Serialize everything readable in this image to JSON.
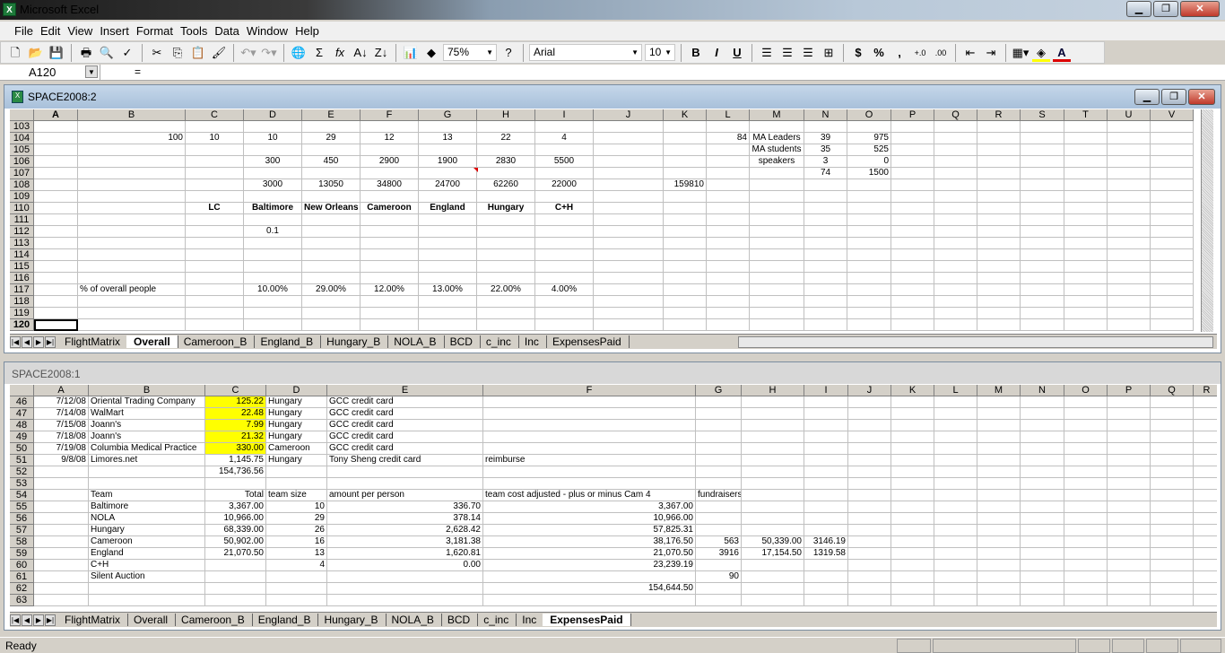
{
  "app": {
    "title": "Microsoft Excel"
  },
  "menu": [
    "File",
    "Edit",
    "View",
    "Insert",
    "Format",
    "Tools",
    "Data",
    "Window",
    "Help"
  ],
  "toolbar": {
    "zoom": "75%",
    "font": "Arial",
    "size": "10",
    "bold": "B",
    "italic": "I",
    "underline": "U",
    "currency": "$",
    "percent": "%",
    "comma": ","
  },
  "formula": {
    "name_box": "A120",
    "eq": "=",
    "value": ""
  },
  "win_top": {
    "title": "SPACE2008:2",
    "columns": [
      "A",
      "B",
      "C",
      "D",
      "E",
      "F",
      "G",
      "H",
      "I",
      "J",
      "K",
      "L",
      "M",
      "N",
      "O",
      "P",
      "Q",
      "R",
      "S",
      "T",
      "U",
      "V"
    ],
    "row_numbers": [
      "103",
      "104",
      "105",
      "106",
      "107",
      "108",
      "109",
      "110",
      "111",
      "112",
      "113",
      "114",
      "115",
      "116",
      "117",
      "118",
      "119",
      "120"
    ],
    "active_row": "120",
    "cells": [
      {
        "r": 1,
        "c": "B",
        "v": "100",
        "a": "r"
      },
      {
        "r": 1,
        "c": "C",
        "v": "10",
        "a": "c"
      },
      {
        "r": 1,
        "c": "D",
        "v": "10",
        "a": "c"
      },
      {
        "r": 1,
        "c": "E",
        "v": "29",
        "a": "c"
      },
      {
        "r": 1,
        "c": "F",
        "v": "12",
        "a": "c"
      },
      {
        "r": 1,
        "c": "G",
        "v": "13",
        "a": "c"
      },
      {
        "r": 1,
        "c": "H",
        "v": "22",
        "a": "c"
      },
      {
        "r": 1,
        "c": "I",
        "v": "4",
        "a": "c"
      },
      {
        "r": 1,
        "c": "L",
        "v": "84",
        "a": "r"
      },
      {
        "r": 1,
        "c": "M",
        "v": "MA Leaders",
        "a": "c"
      },
      {
        "r": 1,
        "c": "N",
        "v": "39",
        "a": "c"
      },
      {
        "r": 1,
        "c": "O",
        "v": "975",
        "a": "r"
      },
      {
        "r": 2,
        "c": "M",
        "v": "MA students",
        "a": "c"
      },
      {
        "r": 2,
        "c": "N",
        "v": "35",
        "a": "c"
      },
      {
        "r": 2,
        "c": "O",
        "v": "525",
        "a": "r"
      },
      {
        "r": 3,
        "c": "D",
        "v": "300",
        "a": "c"
      },
      {
        "r": 3,
        "c": "E",
        "v": "450",
        "a": "c"
      },
      {
        "r": 3,
        "c": "F",
        "v": "2900",
        "a": "c"
      },
      {
        "r": 3,
        "c": "G",
        "v": "1900",
        "a": "c"
      },
      {
        "r": 3,
        "c": "H",
        "v": "2830",
        "a": "c"
      },
      {
        "r": 3,
        "c": "I",
        "v": "5500",
        "a": "c"
      },
      {
        "r": 3,
        "c": "M",
        "v": "speakers",
        "a": "c"
      },
      {
        "r": 3,
        "c": "N",
        "v": "3",
        "a": "c"
      },
      {
        "r": 3,
        "c": "O",
        "v": "0",
        "a": "r"
      },
      {
        "r": 4,
        "c": "N",
        "v": "74",
        "a": "c"
      },
      {
        "r": 4,
        "c": "O",
        "v": "1500",
        "a": "r"
      },
      {
        "r": 5,
        "c": "D",
        "v": "3000",
        "a": "c"
      },
      {
        "r": 5,
        "c": "E",
        "v": "13050",
        "a": "c"
      },
      {
        "r": 5,
        "c": "F",
        "v": "34800",
        "a": "c"
      },
      {
        "r": 5,
        "c": "G",
        "v": "24700",
        "a": "c"
      },
      {
        "r": 5,
        "c": "H",
        "v": "62260",
        "a": "c"
      },
      {
        "r": 5,
        "c": "I",
        "v": "22000",
        "a": "c"
      },
      {
        "r": 5,
        "c": "K",
        "v": "159810",
        "a": "r"
      },
      {
        "r": 7,
        "c": "C",
        "v": "LC",
        "a": "c b"
      },
      {
        "r": 7,
        "c": "D",
        "v": "Baltimore",
        "a": "c b"
      },
      {
        "r": 7,
        "c": "E",
        "v": "New Orleans",
        "a": "c b"
      },
      {
        "r": 7,
        "c": "F",
        "v": "Cameroon",
        "a": "c b"
      },
      {
        "r": 7,
        "c": "G",
        "v": "England",
        "a": "c b"
      },
      {
        "r": 7,
        "c": "H",
        "v": "Hungary",
        "a": "c b"
      },
      {
        "r": 7,
        "c": "I",
        "v": "C+H",
        "a": "c b"
      },
      {
        "r": 9,
        "c": "D",
        "v": "0.1",
        "a": "c"
      },
      {
        "r": 14,
        "c": "B",
        "v": "% of overall people",
        "a": ""
      },
      {
        "r": 14,
        "c": "D",
        "v": "10.00%",
        "a": "c"
      },
      {
        "r": 14,
        "c": "E",
        "v": "29.00%",
        "a": "c"
      },
      {
        "r": 14,
        "c": "F",
        "v": "12.00%",
        "a": "c"
      },
      {
        "r": 14,
        "c": "G",
        "v": "13.00%",
        "a": "c"
      },
      {
        "r": 14,
        "c": "H",
        "v": "22.00%",
        "a": "c"
      },
      {
        "r": 14,
        "c": "I",
        "v": "4.00%",
        "a": "c"
      }
    ],
    "tabs": [
      "FlightMatrix",
      "Overall",
      "Cameroon_B",
      "England_B",
      "Hungary_B",
      "NOLA_B",
      "BCD",
      "c_inc",
      "Inc",
      "ExpensesPaid"
    ],
    "active_tab": "Overall"
  },
  "win_bottom": {
    "title": "SPACE2008:1",
    "columns": [
      "A",
      "B",
      "C",
      "D",
      "E",
      "F",
      "G",
      "H",
      "I",
      "J",
      "K",
      "L",
      "M",
      "N",
      "O",
      "P",
      "Q",
      "R"
    ],
    "row_numbers": [
      "46",
      "47",
      "48",
      "49",
      "50",
      "51",
      "52",
      "53",
      "54",
      "55",
      "56",
      "57",
      "58",
      "59",
      "60",
      "61",
      "62",
      "63"
    ],
    "cells": [
      {
        "r": 0,
        "c": "A",
        "v": "7/12/08",
        "a": "r"
      },
      {
        "r": 0,
        "c": "B",
        "v": "Oriental Trading Company",
        "a": ""
      },
      {
        "r": 0,
        "c": "C",
        "v": "125.22",
        "a": "r y"
      },
      {
        "r": 0,
        "c": "D",
        "v": "Hungary",
        "a": ""
      },
      {
        "r": 0,
        "c": "E",
        "v": "GCC credit card",
        "a": ""
      },
      {
        "r": 1,
        "c": "A",
        "v": "7/14/08",
        "a": "r"
      },
      {
        "r": 1,
        "c": "B",
        "v": "WalMart",
        "a": ""
      },
      {
        "r": 1,
        "c": "C",
        "v": "22.48",
        "a": "r y"
      },
      {
        "r": 1,
        "c": "D",
        "v": "Hungary",
        "a": ""
      },
      {
        "r": 1,
        "c": "E",
        "v": "GCC credit card",
        "a": ""
      },
      {
        "r": 2,
        "c": "A",
        "v": "7/15/08",
        "a": "r"
      },
      {
        "r": 2,
        "c": "B",
        "v": "Joann's",
        "a": ""
      },
      {
        "r": 2,
        "c": "C",
        "v": "7.99",
        "a": "r y"
      },
      {
        "r": 2,
        "c": "D",
        "v": "Hungary",
        "a": ""
      },
      {
        "r": 2,
        "c": "E",
        "v": "GCC credit card",
        "a": ""
      },
      {
        "r": 3,
        "c": "A",
        "v": "7/18/08",
        "a": "r"
      },
      {
        "r": 3,
        "c": "B",
        "v": "Joann's",
        "a": ""
      },
      {
        "r": 3,
        "c": "C",
        "v": "21.32",
        "a": "r y"
      },
      {
        "r": 3,
        "c": "D",
        "v": "Hungary",
        "a": ""
      },
      {
        "r": 3,
        "c": "E",
        "v": "GCC credit card",
        "a": ""
      },
      {
        "r": 4,
        "c": "A",
        "v": "7/19/08",
        "a": "r"
      },
      {
        "r": 4,
        "c": "B",
        "v": "Columbia Medical Practice",
        "a": ""
      },
      {
        "r": 4,
        "c": "C",
        "v": "330.00",
        "a": "r y"
      },
      {
        "r": 4,
        "c": "D",
        "v": "Cameroon",
        "a": ""
      },
      {
        "r": 4,
        "c": "E",
        "v": "GCC credit card",
        "a": ""
      },
      {
        "r": 5,
        "c": "A",
        "v": "9/8/08",
        "a": "r"
      },
      {
        "r": 5,
        "c": "B",
        "v": "Limores.net",
        "a": ""
      },
      {
        "r": 5,
        "c": "C",
        "v": "1,145.75",
        "a": "r"
      },
      {
        "r": 5,
        "c": "D",
        "v": "Hungary",
        "a": ""
      },
      {
        "r": 5,
        "c": "E",
        "v": "Tony Sheng credit card",
        "a": ""
      },
      {
        "r": 5,
        "c": "F",
        "v": "reimburse",
        "a": ""
      },
      {
        "r": 6,
        "c": "C",
        "v": "154,736.56",
        "a": "r"
      },
      {
        "r": 8,
        "c": "B",
        "v": "Team",
        "a": ""
      },
      {
        "r": 8,
        "c": "C",
        "v": "Total",
        "a": "r"
      },
      {
        "r": 8,
        "c": "D",
        "v": "team size",
        "a": ""
      },
      {
        "r": 8,
        "c": "E",
        "v": "amount per person",
        "a": ""
      },
      {
        "r": 8,
        "c": "F",
        "v": "team cost adjusted - plus or minus Cam 4",
        "a": ""
      },
      {
        "r": 8,
        "c": "G",
        "v": "fundraisers",
        "a": ""
      },
      {
        "r": 9,
        "c": "B",
        "v": "Baltimore",
        "a": ""
      },
      {
        "r": 9,
        "c": "C",
        "v": "3,367.00",
        "a": "r"
      },
      {
        "r": 9,
        "c": "D",
        "v": "10",
        "a": "r"
      },
      {
        "r": 9,
        "c": "E",
        "v": "336.70",
        "a": "r"
      },
      {
        "r": 9,
        "c": "F",
        "v": "3,367.00",
        "a": "r"
      },
      {
        "r": 10,
        "c": "B",
        "v": "NOLA",
        "a": ""
      },
      {
        "r": 10,
        "c": "C",
        "v": "10,966.00",
        "a": "r"
      },
      {
        "r": 10,
        "c": "D",
        "v": "29",
        "a": "r"
      },
      {
        "r": 10,
        "c": "E",
        "v": "378.14",
        "a": "r"
      },
      {
        "r": 10,
        "c": "F",
        "v": "10,966.00",
        "a": "r"
      },
      {
        "r": 11,
        "c": "B",
        "v": "Hungary",
        "a": ""
      },
      {
        "r": 11,
        "c": "C",
        "v": "68,339.00",
        "a": "r"
      },
      {
        "r": 11,
        "c": "D",
        "v": "26",
        "a": "r"
      },
      {
        "r": 11,
        "c": "E",
        "v": "2,628.42",
        "a": "r"
      },
      {
        "r": 11,
        "c": "F",
        "v": "57,825.31",
        "a": "r"
      },
      {
        "r": 12,
        "c": "B",
        "v": "Cameroon",
        "a": ""
      },
      {
        "r": 12,
        "c": "C",
        "v": "50,902.00",
        "a": "r"
      },
      {
        "r": 12,
        "c": "D",
        "v": "16",
        "a": "r"
      },
      {
        "r": 12,
        "c": "E",
        "v": "3,181.38",
        "a": "r"
      },
      {
        "r": 12,
        "c": "F",
        "v": "38,176.50",
        "a": "r"
      },
      {
        "r": 12,
        "c": "G",
        "v": "563",
        "a": "r"
      },
      {
        "r": 12,
        "c": "H",
        "v": "50,339.00",
        "a": "r"
      },
      {
        "r": 12,
        "c": "I",
        "v": "3146.19",
        "a": "r"
      },
      {
        "r": 13,
        "c": "B",
        "v": "England",
        "a": ""
      },
      {
        "r": 13,
        "c": "C",
        "v": "21,070.50",
        "a": "r"
      },
      {
        "r": 13,
        "c": "D",
        "v": "13",
        "a": "r"
      },
      {
        "r": 13,
        "c": "E",
        "v": "1,620.81",
        "a": "r"
      },
      {
        "r": 13,
        "c": "F",
        "v": "21,070.50",
        "a": "r"
      },
      {
        "r": 13,
        "c": "G",
        "v": "3916",
        "a": "r"
      },
      {
        "r": 13,
        "c": "H",
        "v": "17,154.50",
        "a": "r"
      },
      {
        "r": 13,
        "c": "I",
        "v": "1319.58",
        "a": "r"
      },
      {
        "r": 14,
        "c": "B",
        "v": "C+H",
        "a": ""
      },
      {
        "r": 14,
        "c": "D",
        "v": "4",
        "a": "r"
      },
      {
        "r": 14,
        "c": "E",
        "v": "0.00",
        "a": "r"
      },
      {
        "r": 14,
        "c": "F",
        "v": "23,239.19",
        "a": "r"
      },
      {
        "r": 15,
        "c": "B",
        "v": "Silent Auction",
        "a": ""
      },
      {
        "r": 15,
        "c": "G",
        "v": "90",
        "a": "r"
      },
      {
        "r": 16,
        "c": "F",
        "v": "154,644.50",
        "a": "r"
      }
    ],
    "tabs": [
      "FlightMatrix",
      "Overall",
      "Cameroon_B",
      "England_B",
      "Hungary_B",
      "NOLA_B",
      "BCD",
      "c_inc",
      "Inc",
      "ExpensesPaid"
    ],
    "active_tab": "ExpensesPaid"
  },
  "status": {
    "text": "Ready"
  }
}
